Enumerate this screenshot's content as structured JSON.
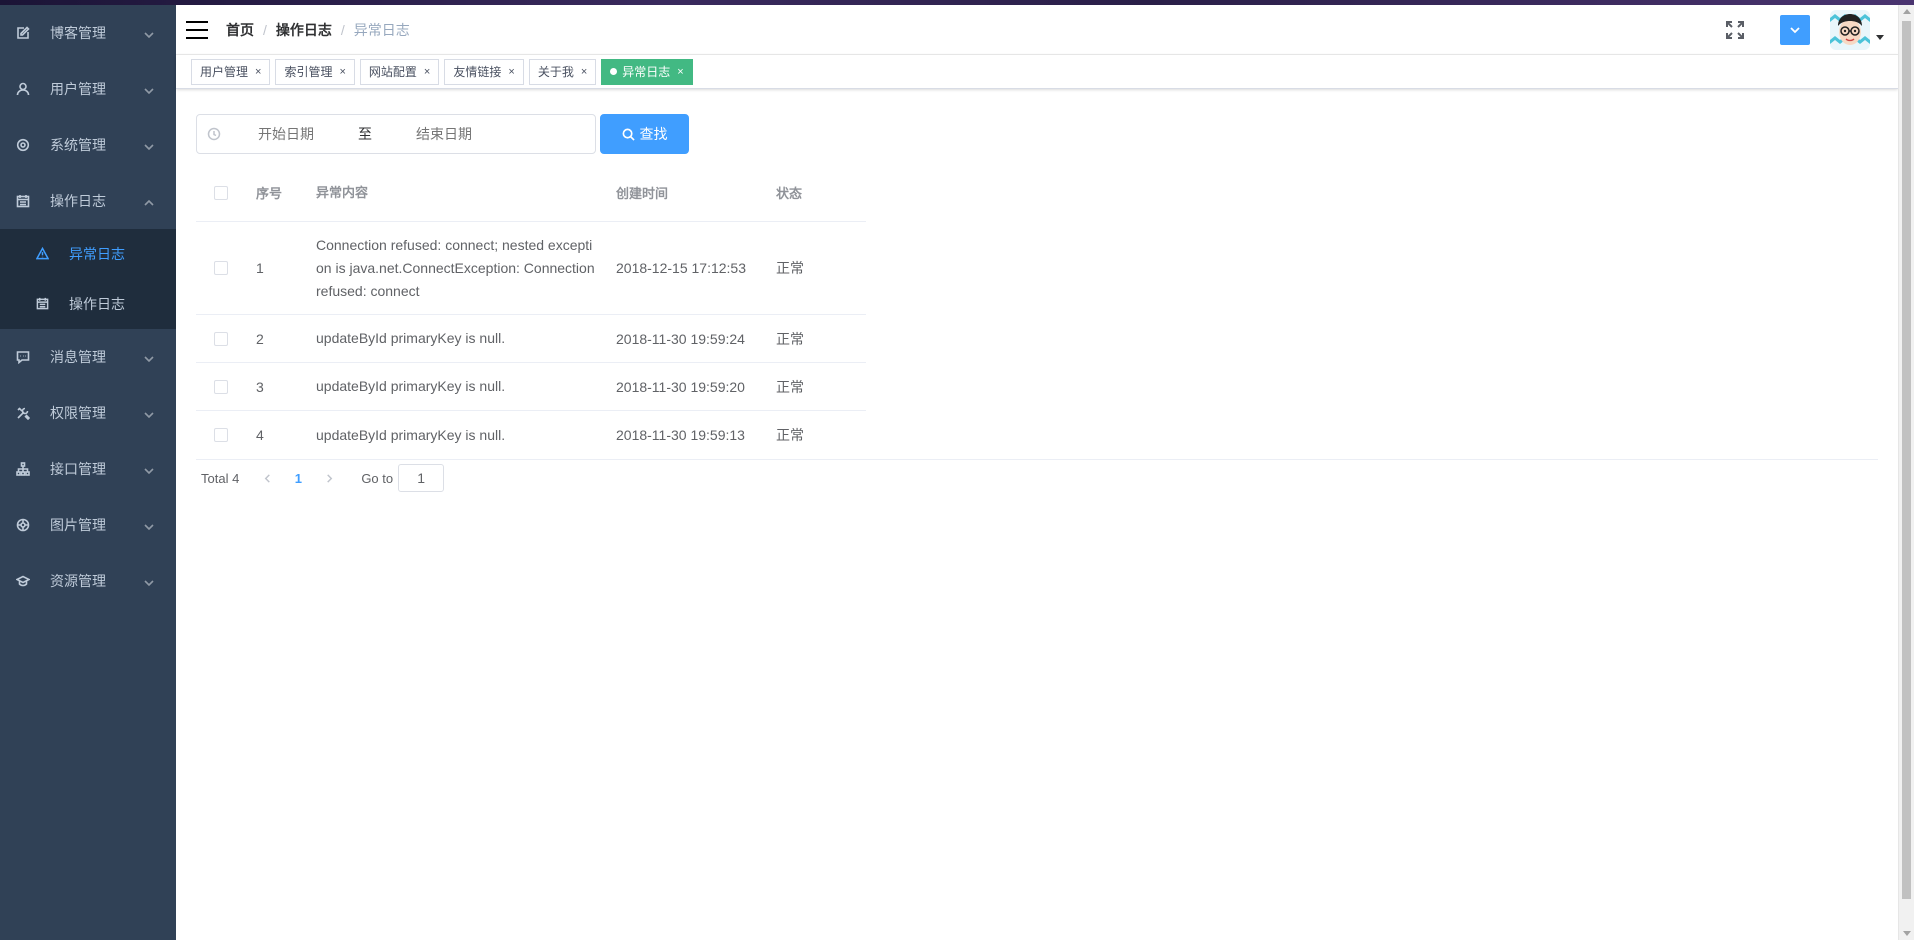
{
  "sidebar": {
    "items": [
      {
        "label": "博客管理",
        "icon": "edit-icon"
      },
      {
        "label": "用户管理",
        "icon": "user-icon"
      },
      {
        "label": "系统管理",
        "icon": "gear-icon"
      },
      {
        "label": "操作日志",
        "icon": "calendar-icon",
        "expanded": true,
        "children": [
          {
            "label": "异常日志",
            "icon": "warning-icon",
            "active": true
          },
          {
            "label": "操作日志",
            "icon": "calendar-icon"
          }
        ]
      },
      {
        "label": "消息管理",
        "icon": "message-icon"
      },
      {
        "label": "权限管理",
        "icon": "tools-icon"
      },
      {
        "label": "接口管理",
        "icon": "sitemap-icon"
      },
      {
        "label": "图片管理",
        "icon": "picture-icon"
      },
      {
        "label": "资源管理",
        "icon": "graduation-cap-icon"
      }
    ],
    "colors": {
      "background": "#304156",
      "submenu_background": "#1f2d3d",
      "text": "#bfcbd9",
      "active": "#409eff"
    }
  },
  "navbar": {
    "breadcrumb": [
      "首页",
      "操作日志",
      "异常日志"
    ]
  },
  "tags": [
    {
      "label": "用户管理",
      "active": false
    },
    {
      "label": "索引管理",
      "active": false
    },
    {
      "label": "网站配置",
      "active": false
    },
    {
      "label": "友情链接",
      "active": false
    },
    {
      "label": "关于我",
      "active": false
    },
    {
      "label": "异常日志",
      "active": true
    }
  ],
  "tag_close": "×",
  "filter": {
    "start_placeholder": "开始日期",
    "separator": "至",
    "end_placeholder": "结束日期",
    "search_label": "查找"
  },
  "table": {
    "columns": [
      "序号",
      "异常内容",
      "创建时间",
      "状态"
    ],
    "rows": [
      {
        "index": "1",
        "content": "Connection refused: connect; nested excepti on is java.net.ConnectException: Connection refused: connect",
        "time": "2018-12-15 17:12:53",
        "status": "正常"
      },
      {
        "index": "2",
        "content": "updateById primaryKey is null.",
        "time": "2018-11-30 19:59:24",
        "status": "正常"
      },
      {
        "index": "3",
        "content": "updateById primaryKey is null.",
        "time": "2018-11-30 19:59:20",
        "status": "正常"
      },
      {
        "index": "4",
        "content": "updateById primaryKey is null.",
        "time": "2018-11-30 19:59:13",
        "status": "正常"
      }
    ]
  },
  "pagination": {
    "total_label": "Total 4",
    "current_page": "1",
    "goto_label": "Go to",
    "goto_value": "1"
  },
  "colors": {
    "primary": "#409eff",
    "active_tag": "#42b983"
  }
}
